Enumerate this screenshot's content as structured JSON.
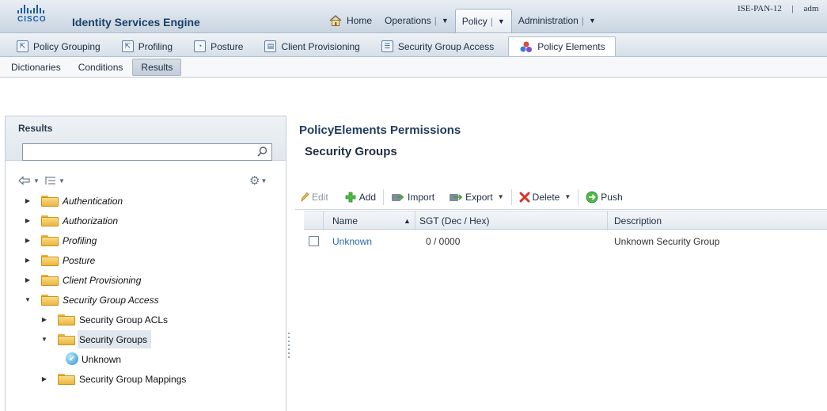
{
  "header": {
    "brand_word": "CISCO",
    "product_name": "Identity Services Engine",
    "host": "ISE-PAN-12",
    "separator": "|",
    "user": "adm"
  },
  "top_nav": [
    {
      "label": "Home",
      "icon": "home-icon"
    },
    {
      "label": "Operations",
      "dropdown": true
    },
    {
      "label": "Policy",
      "dropdown": true,
      "active": true
    },
    {
      "label": "Administration",
      "dropdown": true
    }
  ],
  "module_tabs": [
    {
      "label": "Policy Grouping",
      "icon": "policy-grouping-icon"
    },
    {
      "label": "Profiling",
      "icon": "profiling-icon"
    },
    {
      "label": "Posture",
      "icon": "posture-icon"
    },
    {
      "label": "Client Provisioning",
      "icon": "client-provisioning-icon"
    },
    {
      "label": "Security Group Access",
      "icon": "security-group-access-icon"
    },
    {
      "label": "Policy Elements",
      "icon": "policy-elements-icon",
      "active": true
    }
  ],
  "sub_tabs": [
    {
      "label": "Dictionaries"
    },
    {
      "label": "Conditions"
    },
    {
      "label": "Results",
      "active": true
    }
  ],
  "left_panel": {
    "title": "Results",
    "search_value": "",
    "tree": [
      {
        "label": "Authentication",
        "italic": true,
        "expanded": false,
        "level": 0,
        "icon": "folder-icon"
      },
      {
        "label": "Authorization",
        "italic": true,
        "expanded": false,
        "level": 0,
        "icon": "folder-icon"
      },
      {
        "label": "Profiling",
        "italic": true,
        "expanded": false,
        "level": 0,
        "icon": "folder-icon"
      },
      {
        "label": "Posture",
        "italic": true,
        "expanded": false,
        "level": 0,
        "icon": "folder-icon"
      },
      {
        "label": "Client Provisioning",
        "italic": true,
        "expanded": false,
        "level": 0,
        "icon": "folder-icon"
      },
      {
        "label": "Security Group Access",
        "italic": true,
        "expanded": true,
        "level": 0,
        "icon": "folder-icon"
      },
      {
        "label": "Security Group ACLs",
        "italic": false,
        "expanded": false,
        "level": 1,
        "icon": "folder-icon"
      },
      {
        "label": "Security Groups",
        "italic": false,
        "expanded": true,
        "level": 1,
        "icon": "folder-icon",
        "selected": true
      },
      {
        "label": "Unknown",
        "italic": false,
        "level": 2,
        "icon": "security-group-check-icon",
        "leaf": true
      },
      {
        "label": "Security Group Mappings",
        "italic": false,
        "expanded": false,
        "level": 1,
        "icon": "folder-icon"
      }
    ]
  },
  "content": {
    "page_title": "PolicyElements Permissions",
    "section_title": "Security Groups",
    "actions": [
      {
        "label": "Edit",
        "icon": "pencil-icon",
        "disabled": true
      },
      {
        "label": "Add",
        "icon": "add-icon"
      },
      {
        "label": "Import",
        "icon": "import-icon"
      },
      {
        "label": "Export",
        "icon": "export-icon",
        "dropdown": true
      },
      {
        "label": "Delete",
        "icon": "delete-icon",
        "dropdown": true
      },
      {
        "label": "Push",
        "icon": "push-icon"
      }
    ],
    "table": {
      "columns": [
        "Name",
        "SGT (Dec / Hex)",
        "Description"
      ],
      "sort_indicator": "▲",
      "rows": [
        {
          "name": "Unknown",
          "sgt": "0 / 0000",
          "description": "Unknown Security Group"
        }
      ]
    }
  },
  "colors": {
    "brand_blue": "#1b5da0",
    "link_blue": "#2a6ab1",
    "folder_yellow": "#ecb53f",
    "add_green": "#3aa83a",
    "delete_red": "#d6332a"
  }
}
